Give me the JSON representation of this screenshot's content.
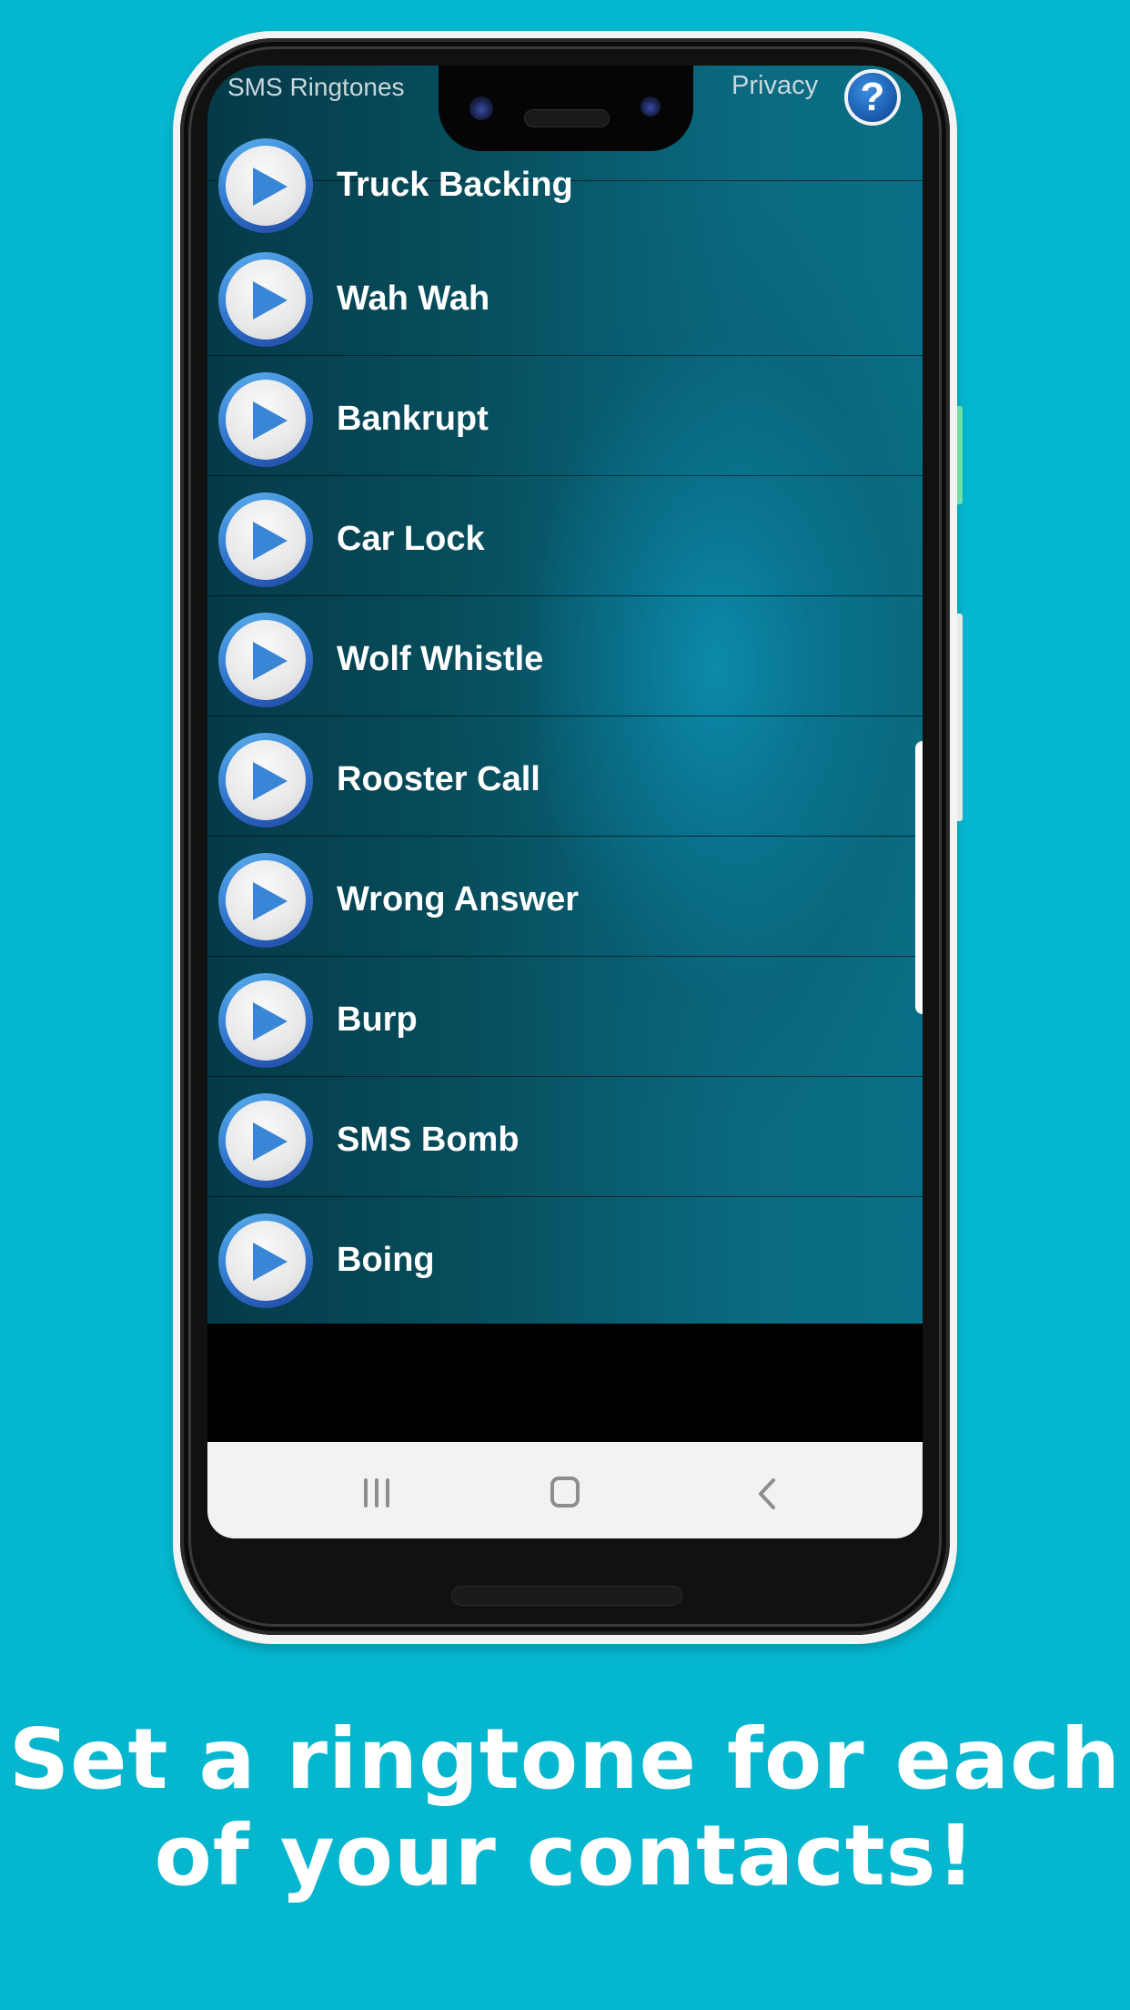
{
  "colors": {
    "page_background": "#05b6cf",
    "list_background_dark": "#053a48",
    "list_background_highlight": "#0a8ab0",
    "play_icon_blue": "#3a86d6",
    "navbar_background": "#f2f2f2",
    "tagline_text": "#ffffff"
  },
  "app": {
    "title": "SMS Ringtones",
    "privacy_label": "Privacy",
    "help_icon": "question-mark-icon",
    "help_glyph": "?"
  },
  "ringtones": [
    {
      "name": "Truck Backing",
      "icon": "play-icon"
    },
    {
      "name": "Wah Wah",
      "icon": "play-icon"
    },
    {
      "name": "Bankrupt",
      "icon": "play-icon"
    },
    {
      "name": "Car Lock",
      "icon": "play-icon"
    },
    {
      "name": "Wolf Whistle",
      "icon": "play-icon"
    },
    {
      "name": "Rooster Call",
      "icon": "play-icon"
    },
    {
      "name": "Wrong Answer",
      "icon": "play-icon"
    },
    {
      "name": "Burp",
      "icon": "play-icon"
    },
    {
      "name": "SMS Bomb",
      "icon": "play-icon"
    },
    {
      "name": "Boing",
      "icon": "play-icon"
    }
  ],
  "system_nav": {
    "recents_icon": "recent-apps-icon",
    "home_icon": "home-icon",
    "back_icon": "back-icon"
  },
  "tagline": {
    "line1": "Set a ringtone for each",
    "line2": "of your contacts!"
  }
}
